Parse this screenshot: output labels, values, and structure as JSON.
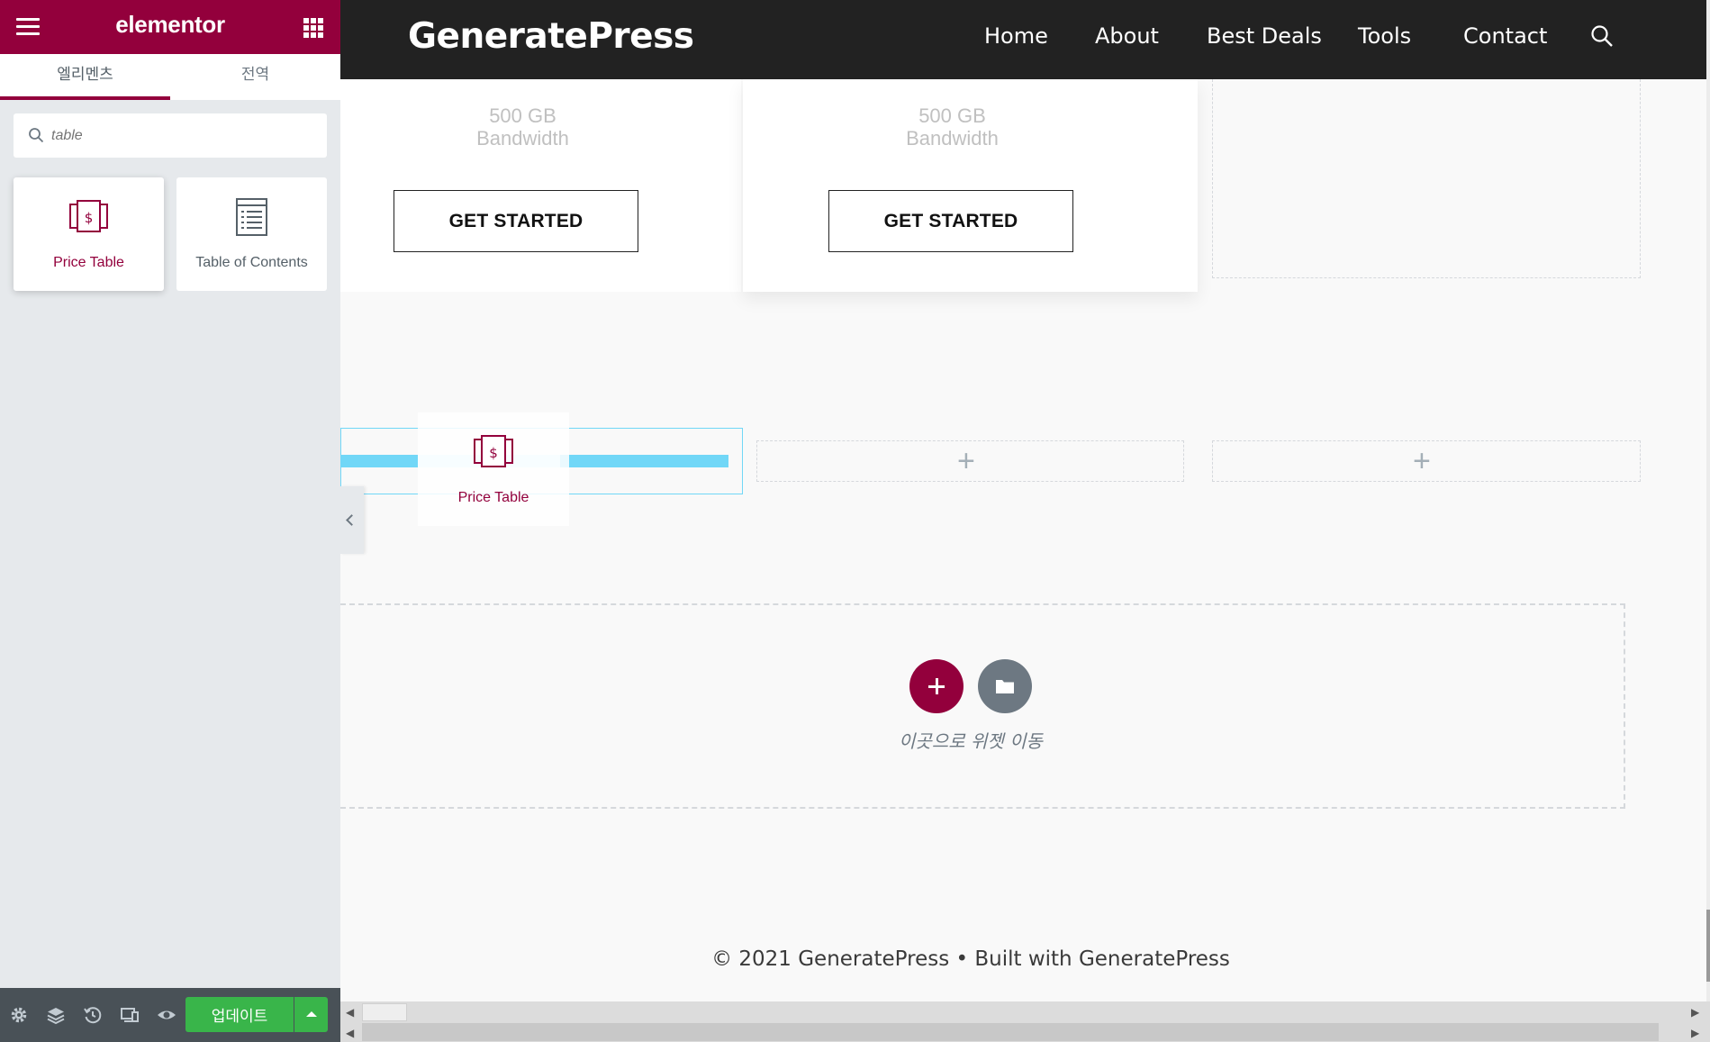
{
  "panel": {
    "brand": "elementor",
    "tabs": [
      {
        "label": "엘리멘츠",
        "active": true
      },
      {
        "label": "전역",
        "active": false
      }
    ],
    "search": {
      "value": "",
      "placeholder": "table"
    },
    "widgets": [
      {
        "label": "Price Table",
        "icon": "price-table-icon",
        "highlighted": true
      },
      {
        "label": "Table of Contents",
        "icon": "table-of-contents-icon",
        "highlighted": false
      }
    ],
    "footer": {
      "icons": [
        "gear-icon",
        "layers-icon",
        "history-icon",
        "responsive-icon",
        "eye-icon"
      ],
      "update_label": "업데이트"
    }
  },
  "site": {
    "title": "GeneratePress",
    "nav": [
      "Home",
      "About",
      "Best Deals",
      "Tools",
      "Contact"
    ],
    "pricing_cards": [
      {
        "bandwidth_value": "500 GB",
        "bandwidth_label": "Bandwidth",
        "button": "GET STARTED"
      },
      {
        "bandwidth_value": "500 GB",
        "bandwidth_label": "Bandwidth",
        "button": "GET STARTED"
      }
    ],
    "dragged_widget": {
      "label": "Price Table"
    },
    "add_section": {
      "hint": "이곳으로 위젯 이동"
    },
    "footer": "© 2021 GeneratePress • Built with GeneratePress"
  },
  "colors": {
    "accent": "#93003c",
    "update": "#39b54a",
    "drop_indicator": "#71d7f7",
    "header_bg": "#222222"
  }
}
